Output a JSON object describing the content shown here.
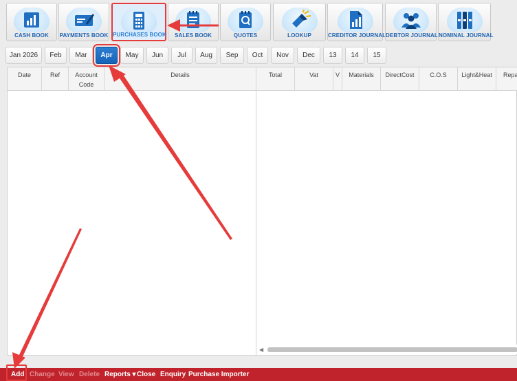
{
  "toolbar": {
    "buttons": [
      {
        "label": "CASH BOOK",
        "icon": "bar-chart-icon"
      },
      {
        "label": "PAYMENTS BOOK",
        "icon": "cheque-icon"
      },
      {
        "label": "PURCHASES BOOK",
        "icon": "calculator-icon",
        "active": true
      },
      {
        "label": "SALES BOOK",
        "icon": "notepad-icon"
      },
      {
        "label": "QUOTES",
        "icon": "quote-pad-icon"
      },
      {
        "label": "LOOKUP",
        "icon": "flashlight-icon"
      },
      {
        "label": "CREDITOR JOURNAL",
        "icon": "document-chart-icon"
      },
      {
        "label": "DEBTOR JOURNAL",
        "icon": "people-icon"
      },
      {
        "label": "NOMINAL JOURNAL",
        "icon": "binders-icon"
      }
    ]
  },
  "months": {
    "items": [
      "Jan 2026",
      "Feb",
      "Mar",
      "Apr",
      "May",
      "Jun",
      "Jul",
      "Aug",
      "Sep",
      "Oct",
      "Nov",
      "Dec",
      "13",
      "14",
      "15"
    ],
    "selected": "Apr"
  },
  "grid": {
    "left_columns": [
      {
        "label": "Date"
      },
      {
        "label": "Ref"
      },
      {
        "label": "Account\nCode"
      },
      {
        "label": "Details"
      }
    ],
    "right_columns": [
      {
        "label": "Total"
      },
      {
        "label": "Vat"
      },
      {
        "label": "V"
      },
      {
        "label": "Materials"
      },
      {
        "label": "DirectCost"
      },
      {
        "label": "C.O.S"
      },
      {
        "label": "Light&Heat"
      },
      {
        "label": "Repa"
      }
    ],
    "rows": []
  },
  "bottom_menu": {
    "items": [
      {
        "label": "Add",
        "enabled": true
      },
      {
        "label": "Change",
        "enabled": false
      },
      {
        "label": "View",
        "enabled": false
      },
      {
        "label": "Delete",
        "enabled": false
      },
      {
        "label": "Reports ▾",
        "enabled": true
      },
      {
        "label": "Close",
        "enabled": true
      },
      {
        "label": "Enquiry",
        "enabled": true
      },
      {
        "label": "Purchase Importer",
        "enabled": true
      }
    ]
  },
  "colors": {
    "accent_blue": "#1663b8",
    "toolbar_label": "#1d63b5",
    "bottom_bar": "#c0232b",
    "annotation_red": "#e53b3b"
  }
}
